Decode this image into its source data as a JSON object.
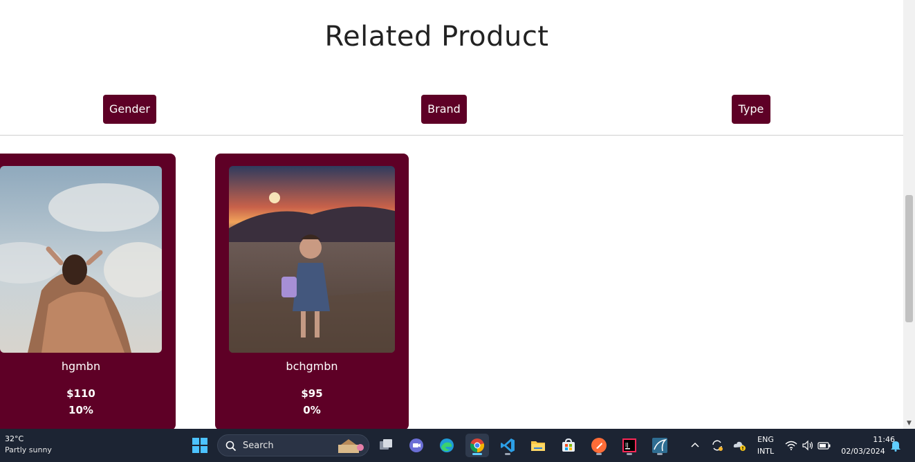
{
  "page": {
    "title": "Related Product",
    "filters": [
      "Gender",
      "Brand",
      "Type"
    ]
  },
  "products": [
    {
      "name": "hgmbn",
      "price": "$110",
      "discount": "10%"
    },
    {
      "name": "bchgmbn",
      "price": "$95",
      "discount": "0%"
    }
  ],
  "colors": {
    "brand": "#5e0026",
    "taskbar": "#1c2433",
    "accent": "#60cdff"
  },
  "taskbar": {
    "weather_temp": "32°C",
    "weather_desc": "Partly sunny",
    "search_label": "Search",
    "lang_top": "ENG",
    "lang_bottom": "INTL",
    "time": "11:46",
    "date": "02/03/2024",
    "apps": [
      "start-icon",
      "search-icon",
      "task-view-icon",
      "meet-icon",
      "edge-icon",
      "chrome-icon",
      "vscode-icon",
      "file-explorer-icon",
      "store-icon",
      "postman-icon",
      "intellij-icon",
      "mysql-workbench-icon"
    ]
  }
}
